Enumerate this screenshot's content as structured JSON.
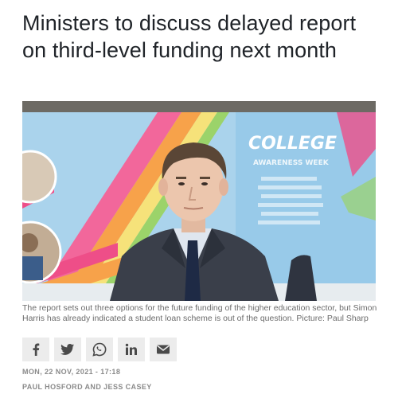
{
  "article": {
    "headline": "Ministers to discuss delayed report on third-level funding next month",
    "photo": {
      "banner_title": "COLLEGE",
      "banner_subtitle": "AWARENESS WEEK"
    },
    "caption": "The report sets out three options for the future funding of the higher education sector, but Simon Harris has already indicated a student loan scheme is out of the question. Picture: Paul Sharp",
    "share_buttons": [
      {
        "icon": "facebook-icon"
      },
      {
        "icon": "twitter-icon"
      },
      {
        "icon": "whatsapp-icon"
      },
      {
        "icon": "linkedin-icon"
      },
      {
        "icon": "email-icon"
      }
    ],
    "date": "MON, 22 NOV, 2021 - 17:18",
    "authors": "PAUL HOSFORD AND JESS CASEY"
  },
  "colors": {
    "headline": "#1f2328",
    "caption": "#6b6b6b",
    "share_button_bg": "#ececec",
    "share_icon": "#4a4a4a",
    "meta": "#8a8a8a"
  }
}
